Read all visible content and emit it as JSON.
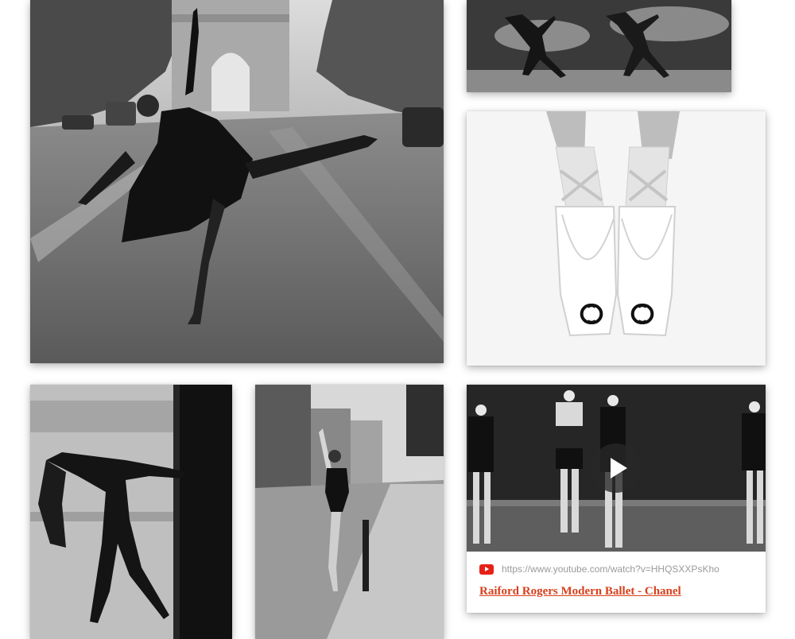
{
  "colors": {
    "link_title": "#d7401d",
    "youtube_red": "#e62117",
    "url_gray": "#9a9a9a"
  },
  "board": {
    "pins": [
      {
        "image": "ballerina-arabesque-champs-elysees-photo"
      },
      {
        "image": "two-dancers-chalk-dust-photo"
      },
      {
        "image": "pointe-shoes-chanel-logo-photo"
      },
      {
        "image": "dancer-backbend-subway-train-photo"
      },
      {
        "image": "ballerina-leg-stretch-city-street-photo"
      }
    ],
    "video_pin": {
      "image": "ballet-dancers-stage-video-thumbnail",
      "source_icon": "youtube-icon",
      "url": "https://www.youtube.com/watch?v=HHQSXXPsKho",
      "title": "Raiford Rogers Modern Ballet - Chanel"
    }
  }
}
